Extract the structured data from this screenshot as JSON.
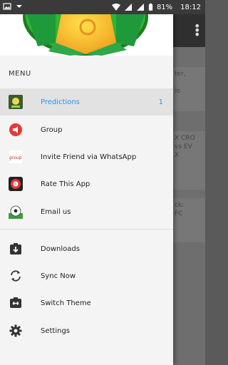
{
  "status_bar": {
    "battery": "81%",
    "time": "18:12"
  },
  "background": {
    "cards": [
      "ter,",
      "io",
      "X CRO",
      "vs EV",
      "X",
      "ck:",
      "FC"
    ]
  },
  "drawer": {
    "menu_title": "MENU",
    "items": [
      {
        "label": "Predictions",
        "icon": "predictions-icon",
        "count": "1",
        "selected": true
      },
      {
        "label": "Group",
        "icon": "group-megaphone-icon"
      },
      {
        "label": "Invite Friend via WhatsApp",
        "icon": "group-text-icon"
      },
      {
        "label": "Rate This App",
        "icon": "rate-ball-icon"
      },
      {
        "label": "Email us",
        "icon": "soccer-ball-icon"
      },
      {
        "label": "Downloads",
        "icon": "download-icon"
      },
      {
        "label": "Sync Now",
        "icon": "sync-icon"
      },
      {
        "label": "Switch Theme",
        "icon": "switch-theme-icon"
      },
      {
        "label": "Settings",
        "icon": "gear-icon"
      }
    ]
  },
  "colors": {
    "accent": "#2196f3",
    "drawer_bg": "#f4f4f4",
    "selected_bg": "#e2e2e2"
  }
}
